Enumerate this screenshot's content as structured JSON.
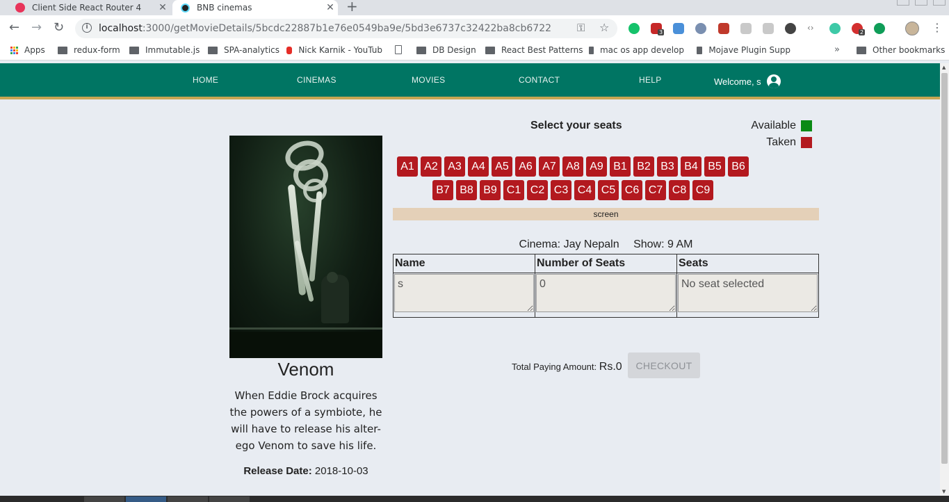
{
  "browser": {
    "tabs": [
      {
        "title": "Client Side React Router 4",
        "active": false
      },
      {
        "title": "BNB cinemas",
        "active": true
      }
    ],
    "address": {
      "host": "localhost",
      "path": ":3000/getMovieDetails/5bcdc22887b1e76e0549ba9e/5bd3e6737c32422ba8cb6722"
    },
    "extension_badges": [
      "3",
      "2"
    ],
    "bookmarks": [
      {
        "label": "Apps",
        "icon": "apps-grid-icon"
      },
      {
        "label": "redux-form",
        "icon": "folder-icon"
      },
      {
        "label": "Immutable.js",
        "icon": "folder-icon"
      },
      {
        "label": "SPA-analytics",
        "icon": "folder-icon"
      },
      {
        "label": "Nick Karnik - YouTub",
        "icon": "youtube-icon"
      },
      {
        "label": "",
        "icon": "page-icon"
      },
      {
        "label": "DB Design",
        "icon": "folder-icon"
      },
      {
        "label": "React Best Patterns",
        "icon": "folder-icon"
      },
      {
        "label": "mac os app develop",
        "icon": "folder-icon"
      },
      {
        "label": "Mojave Plugin Supp",
        "icon": "folder-icon"
      }
    ],
    "bookmarks_overflow": "»",
    "other_bookmarks": "Other bookmarks"
  },
  "nav": {
    "links": [
      "HOME",
      "CINEMAS",
      "MOVIES",
      "CONTACT",
      "HELP"
    ],
    "welcome": "Welcome, s"
  },
  "movie": {
    "title": "Venom",
    "description": "When Eddie Brock acquires the powers of a symbiote, he will have to release his alter-ego Venom to save his life.",
    "release_label": "Release Date:",
    "release_date": "2018-10-03"
  },
  "seating": {
    "title": "Select your seats",
    "legend": [
      {
        "label": "Available",
        "color": "#0a8a14"
      },
      {
        "label": "Taken",
        "color": "#b3191f"
      }
    ],
    "seat_color": "#b3191f",
    "rows": [
      [
        "A1",
        "A2",
        "A3",
        "A4",
        "A5",
        "A6",
        "A7",
        "A8",
        "A9",
        "B1",
        "B2",
        "B3",
        "B4",
        "B5",
        "B6"
      ],
      [
        "B7",
        "B8",
        "B9",
        "C1",
        "C2",
        "C3",
        "C4",
        "C5",
        "C6",
        "C7",
        "C8",
        "C9"
      ]
    ],
    "screen_label": "screen"
  },
  "booking": {
    "cinema_label": "Cinema:",
    "cinema": "Jay Nepaln",
    "show_label": "Show:",
    "show": "9 AM",
    "headers": [
      "Name",
      "Number of Seats",
      "Seats"
    ],
    "values": [
      "s",
      "0",
      "No seat selected"
    ],
    "total_label": "Total Paying Amount:",
    "total_amount": "Rs.0",
    "checkout_label": "CHECKOUT"
  },
  "colors": {
    "navbar": "#007563",
    "navbar_border": "#c7a653",
    "page_bg": "#e8ecf2"
  }
}
